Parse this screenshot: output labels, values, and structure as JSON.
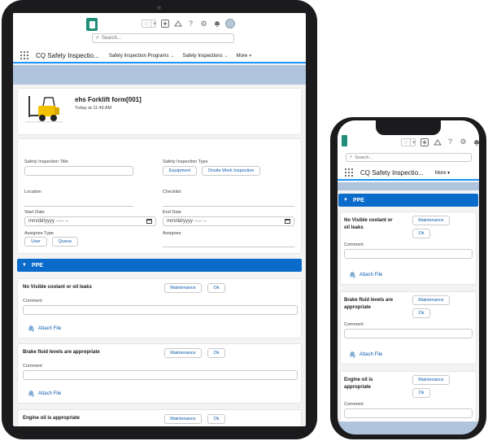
{
  "app": {
    "name": "CQ Safety Inspectio...",
    "search_placeholder": "Search..."
  },
  "tablet": {
    "nav": [
      {
        "label": "Safety Inspection Programs"
      },
      {
        "label": "Safety Inspections"
      },
      {
        "label": "More"
      }
    ],
    "record": {
      "title": "ehs Forklift form[001]",
      "subtitle": "Today at 11:49 AM"
    },
    "form": {
      "safety_inspection_title_label": "Safety Inspection Title",
      "safety_inspection_type_label": "Safety Inspection Type",
      "type_options": [
        "Equipment",
        "Onsite Work Inspection"
      ],
      "location_label": "Location",
      "checklist_label": "Checklist",
      "start_date_label": "Start Date",
      "start_date_value": "mm/dd/yyyy --:-- --",
      "end_date_label": "End Date",
      "end_date_value": "mm/dd/yyyy --:-- --",
      "assignee_type_label": "Assignee Type",
      "assignee_type_options": [
        "User",
        "Queue"
      ],
      "assignee_label": "Assignee"
    }
  },
  "section": {
    "title": "PPE"
  },
  "checklist": [
    {
      "question": "No Visible coolant or oil leaks",
      "phone_question": [
        "No Visible coolant or",
        "oil leaks"
      ],
      "btn_maintenance": "Maintenance",
      "btn_ok": "Ok",
      "comment_label": "Comment",
      "attach_label": "Attach File"
    },
    {
      "question": "Brake fluid levels are appropriate",
      "phone_question": [
        "Brake fluid levels are",
        "appropriate"
      ],
      "btn_maintenance": "Maintenance",
      "btn_ok": "Ok",
      "comment_label": "Comment",
      "attach_label": "Attach File"
    },
    {
      "question": "Engine oil is appropriate",
      "phone_question": [
        "Engine oil is",
        "appropriate"
      ],
      "btn_maintenance": "Maintenance",
      "btn_ok": "Ok",
      "comment_label": "Comment",
      "attach_label": "Attach File"
    }
  ],
  "icons": {
    "header": [
      "star-icon",
      "add-icon",
      "trailhead-icon",
      "help-icon",
      "setup-gear-icon",
      "notification-bell-icon",
      "user-avatar"
    ],
    "search": "search-icon",
    "attach": "paperclip-icon"
  },
  "colors": {
    "brand_blue": "#0b6bcb",
    "link_blue": "#0b5cab",
    "band": "#b0c4de",
    "app_logo": "#1f8f7a"
  }
}
